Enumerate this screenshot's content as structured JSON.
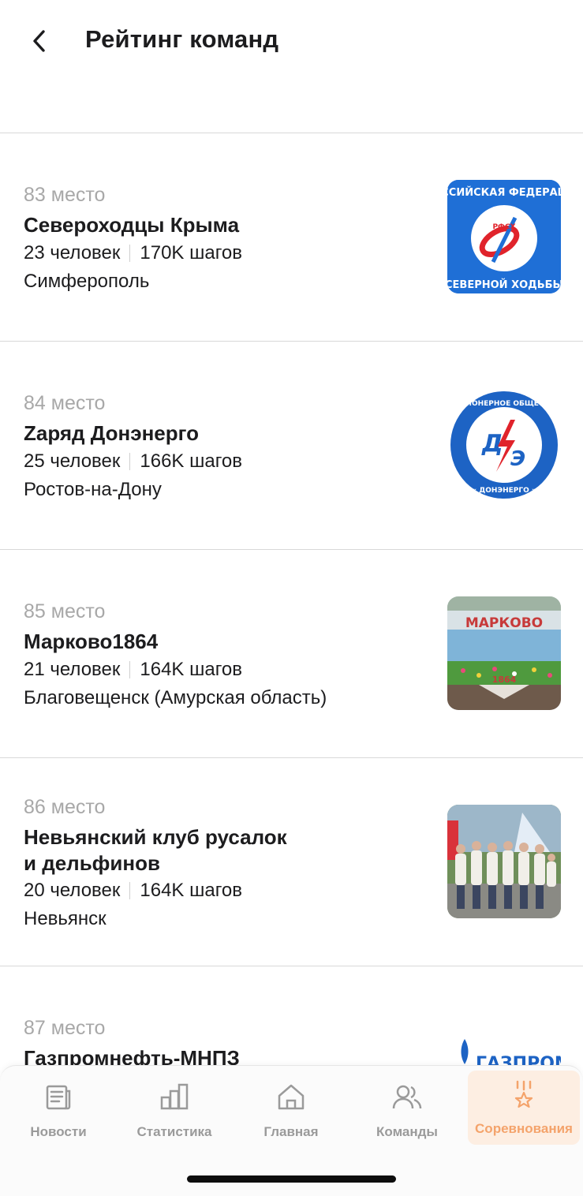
{
  "header": {
    "title": "Рейтинг команд"
  },
  "teams": [
    {
      "place": "83 место",
      "name": "Североходцы Крыма",
      "members": "23 человек",
      "steps": "170K шагов",
      "city": "Симферополь",
      "logo_text_top": "ССИЙСКАЯ ФЕДЕРАЦ",
      "logo_text_mid": "РФСХ",
      "logo_text_bottom": "СЕВЕРНОЙ ХОДЬБЫ"
    },
    {
      "place": "84 место",
      "name": "Zаряд Донэнерго",
      "members": "25 человек",
      "steps": "166K шагов",
      "city": "Ростов-на-Дону",
      "logo_ring_top": "АКЦИОНЕРНОЕ ОБЩЕСТВО",
      "logo_ring_bottom": "« ДОНЭНЕРГО »",
      "logo_letter_left": "Д",
      "logo_letter_right": "Э"
    },
    {
      "place": "85 место",
      "name": "Марково1864",
      "members": "21 человек",
      "steps": "164K шагов",
      "city": "Благовещенск (Амурская область)",
      "sign_text": "МАРКОВО",
      "sign_year": "1864"
    },
    {
      "place": "86 место",
      "name_line1": "Невьянский клуб русалок",
      "name_line2": "и дельфинов",
      "members": "20 человек",
      "steps": "164K шагов",
      "city": "Невьянск"
    },
    {
      "place": "87 место",
      "name": "Газпромнефть-МНПЗ",
      "logo_text": "ГАЗПРОМ"
    }
  ],
  "tabs": [
    {
      "label": "Новости",
      "icon": "news-icon"
    },
    {
      "label": "Статистика",
      "icon": "stats-icon"
    },
    {
      "label": "Главная",
      "icon": "home-icon"
    },
    {
      "label": "Команды",
      "icon": "teams-icon"
    },
    {
      "label": "Соревнования",
      "icon": "competitions-icon",
      "active": true
    }
  ],
  "colors": {
    "accent": "#f4a36b",
    "accent_bg": "#fdeee2",
    "muted": "#a8a8a8",
    "text": "#1c1c1e",
    "tab_inactive": "#9a9a9a"
  }
}
